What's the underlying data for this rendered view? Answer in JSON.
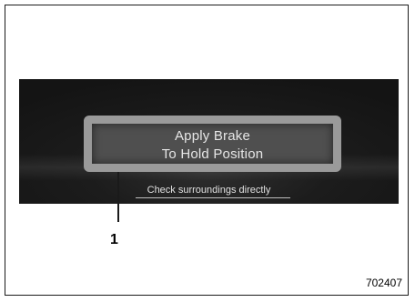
{
  "display": {
    "message_line_1": "Apply Brake",
    "message_line_2": "To Hold Position",
    "footer_text": "Check surroundings directly"
  },
  "callout": {
    "number": "1"
  },
  "figure": {
    "id": "702407"
  },
  "colors": {
    "display_background": "#1c1c1c",
    "message_box_border": "#9a9a9a",
    "message_box_fill": "#4f4f4f",
    "text_light": "#e6e6e6"
  }
}
